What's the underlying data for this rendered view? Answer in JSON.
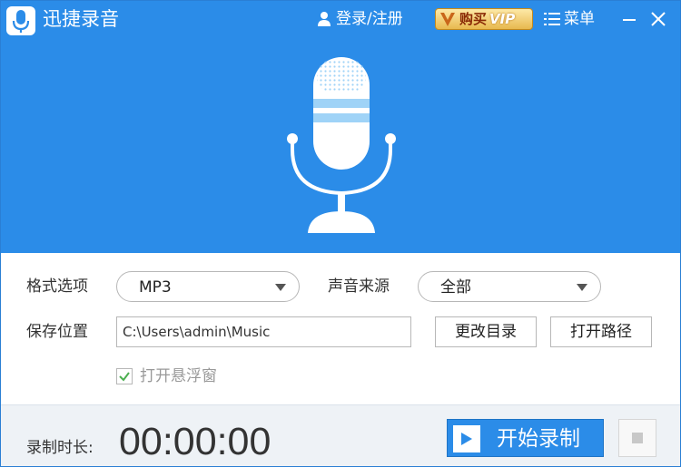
{
  "app": {
    "title": "迅捷录音"
  },
  "header": {
    "login_label": "登录/注册",
    "vip": {
      "buy_label": "购买",
      "vip_label": "VIP"
    },
    "menu_label": "菜单"
  },
  "form": {
    "format": {
      "label": "格式选项",
      "value": "MP3"
    },
    "source": {
      "label": "声音来源",
      "value": "全部"
    },
    "save": {
      "label": "保存位置",
      "path": "C:\\Users\\admin\\Music",
      "change_dir_label": "更改目录",
      "open_path_label": "打开路径"
    },
    "floating_window": {
      "label": "打开悬浮窗",
      "checked": true
    }
  },
  "bottom": {
    "duration_label": "录制时长:",
    "timer": "00:00:00",
    "start_label": "开始录制"
  },
  "icons": {
    "logo": "microphone-icon",
    "login": "user-icon",
    "menu": "hamburger-icon",
    "minimize": "minimize-icon",
    "close": "close-icon",
    "play": "play-icon",
    "stop": "stop-icon"
  },
  "colors": {
    "accent": "#2b8ce8",
    "header_bg": "#2b8ce8",
    "vip_gold": "#e8b94f",
    "mic_stripe": "#9fd3f7"
  }
}
